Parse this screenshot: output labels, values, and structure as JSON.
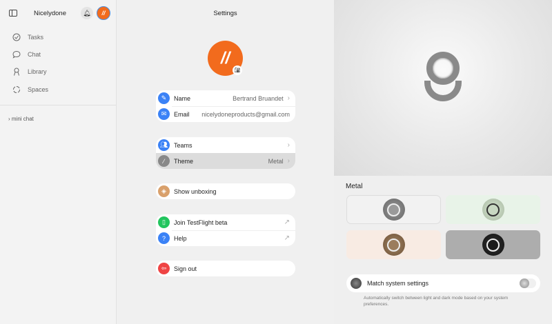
{
  "sidebar": {
    "app_name": "Nicelydone",
    "items": [
      {
        "label": "Tasks",
        "icon": "check-circle-icon"
      },
      {
        "label": "Chat",
        "icon": "chat-bubble-icon"
      },
      {
        "label": "Library",
        "icon": "person-icon"
      },
      {
        "label": "Spaces",
        "icon": "spaces-icon"
      }
    ],
    "mini_chat": "mini chat"
  },
  "settings": {
    "title": "Settings",
    "name": {
      "label": "Name",
      "value": "Bertrand Bruandet"
    },
    "email": {
      "label": "Email",
      "value": "nicelydoneproducts@gmail.com"
    },
    "teams": {
      "label": "Teams"
    },
    "theme": {
      "label": "Theme",
      "value": "Metal"
    },
    "unboxing": {
      "label": "Show unboxing"
    },
    "testflight": {
      "label": "Join TestFlight beta"
    },
    "help": {
      "label": "Help"
    },
    "signout": {
      "label": "Sign out"
    }
  },
  "theme_panel": {
    "title": "Metal",
    "options": [
      "silver",
      "green",
      "bronze",
      "black"
    ],
    "selected": "silver",
    "match": {
      "label": "Match system settings",
      "enabled": false,
      "description": "Automatically switch between light and dark mode based on your system preferences."
    }
  },
  "colors": {
    "accent": "#f26b1d",
    "blue": "#3b82f6",
    "green": "#22c55e",
    "red": "#ef4444"
  }
}
